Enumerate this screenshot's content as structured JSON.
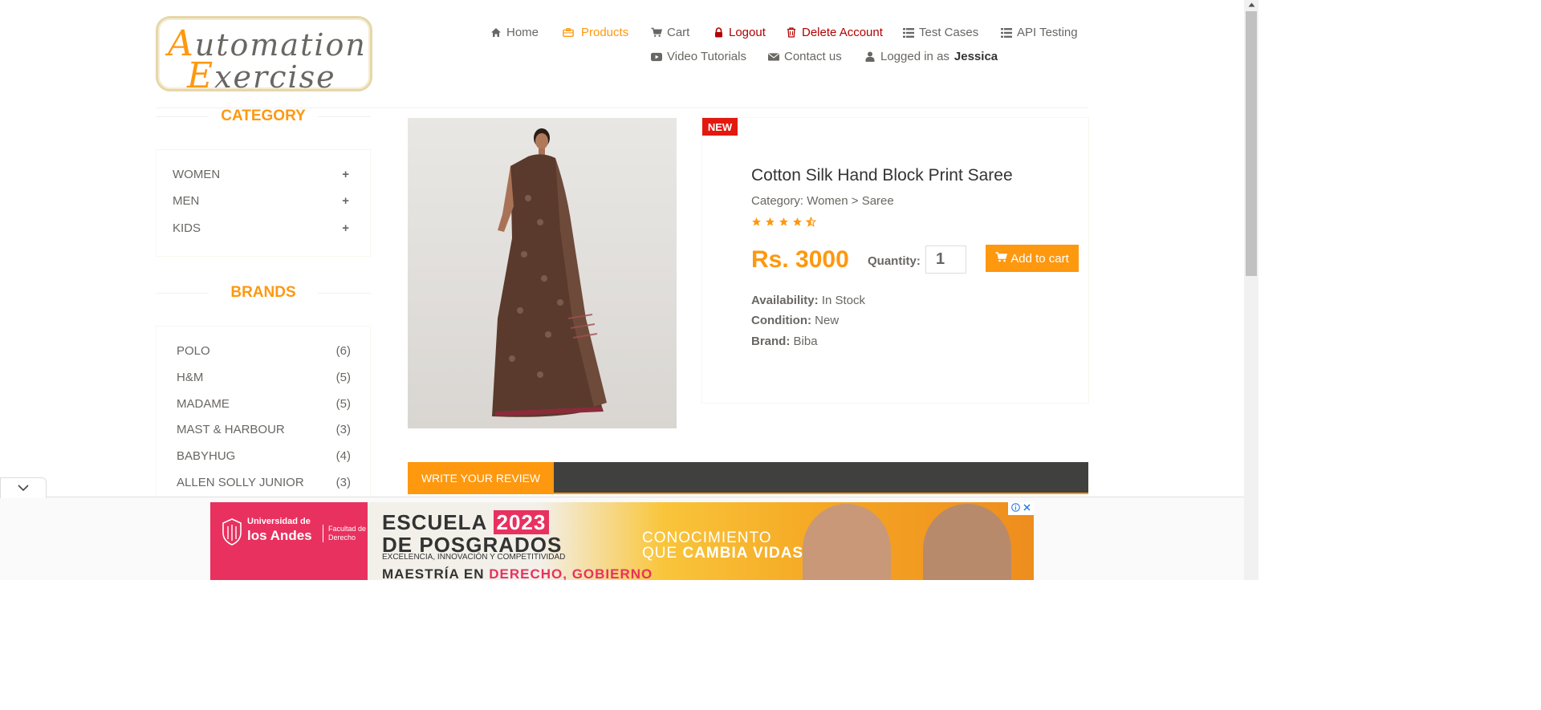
{
  "logo": {
    "line1_cap": "A",
    "line1_rest": "utomation",
    "line2_cap": "E",
    "line2_rest": "xercise"
  },
  "nav": {
    "home": "Home",
    "products": "Products",
    "cart": "Cart",
    "logout": "Logout",
    "delete_account": "Delete Account",
    "test_cases": "Test Cases",
    "api_testing": "API Testing",
    "video_tutorials": "Video Tutorials",
    "contact_us": "Contact us",
    "logged_in_prefix": "Logged in as",
    "username": "Jessica"
  },
  "colors": {
    "accent": "#fe980f",
    "danger": "#b20000",
    "text": "#696763",
    "new_badge": "#e3190f"
  },
  "sidebar": {
    "category_title": "CATEGORY",
    "categories": [
      {
        "label": "WOMEN",
        "toggle": "+"
      },
      {
        "label": "MEN",
        "toggle": "+"
      },
      {
        "label": "KIDS",
        "toggle": "+"
      }
    ],
    "brands_title": "BRANDS",
    "brands": [
      {
        "label": "POLO",
        "count": "(6)"
      },
      {
        "label": "H&M",
        "count": "(5)"
      },
      {
        "label": "MADAME",
        "count": "(5)"
      },
      {
        "label": "MAST & HARBOUR",
        "count": "(3)"
      },
      {
        "label": "BABYHUG",
        "count": "(4)"
      },
      {
        "label": "ALLEN SOLLY JUNIOR",
        "count": "(3)"
      }
    ]
  },
  "product": {
    "badge": "NEW",
    "name": "Cotton Silk Hand Block Print Saree",
    "category": "Category: Women > Saree",
    "rating": 4.5,
    "price": "Rs. 3000",
    "quantity_label": "Quantity:",
    "quantity_value": "1",
    "add_to_cart": "Add to cart",
    "availability_label": "Availability:",
    "availability": "In Stock",
    "condition_label": "Condition:",
    "condition": "New",
    "brand_label": "Brand:",
    "brand": "Biba"
  },
  "review": {
    "tab_label": "WRITE YOUR REVIEW"
  },
  "ad": {
    "uni_line1": "Universidad de",
    "uni_line2": "los Andes",
    "faculty": "Facultad de Derecho",
    "headline1": "ESCUELA",
    "year": "2023",
    "headline2": "DE POSGRADOS",
    "tagline": "EXCELENCIA, INNOVACIÓN Y COMPETITIVIDAD",
    "bottom_prefix": "MAESTRÍA EN",
    "bottom_highlight": "DERECHO, GOBIERNO",
    "slogan1": "CONOCIMIENTO",
    "slogan2_prefix": "QUE",
    "slogan2_bold": "CAMBIA VIDAS"
  }
}
